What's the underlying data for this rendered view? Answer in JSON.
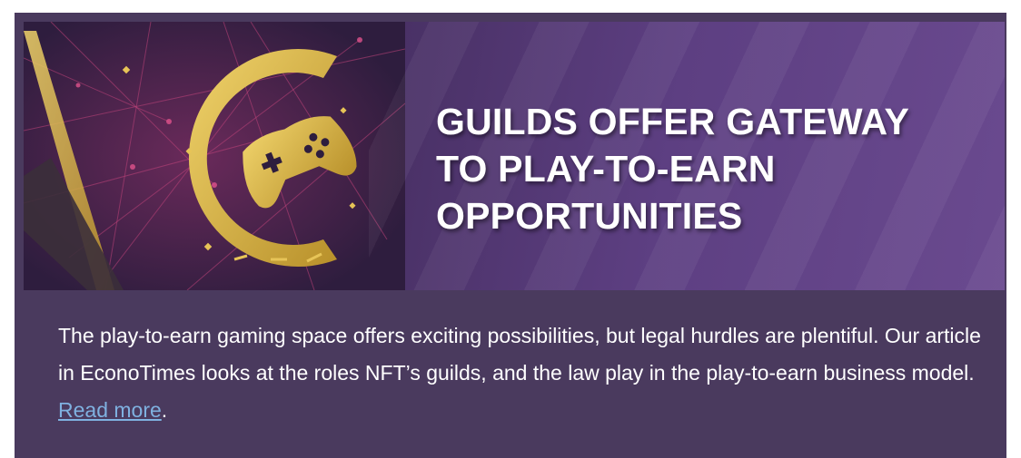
{
  "banner": {
    "headline_lines": [
      "GUILDS OFFER GATEWAY",
      "TO PLAY-TO-EARN",
      "OPPORTUNITIES"
    ],
    "image_icon": "game-controller-icon"
  },
  "article": {
    "text_before_link": "The play-to-earn gaming space offers exciting possibilities, but legal hurdles are plentiful. Our article in EconoTimes looks at the roles NFT’s guilds, and the law play in the play-to-earn business model. ",
    "link_label": "Read more",
    "text_after_link": "."
  },
  "colors": {
    "card_background": "#4a3a5e",
    "link": "#7fb1e0",
    "gold": "#d9b441"
  }
}
